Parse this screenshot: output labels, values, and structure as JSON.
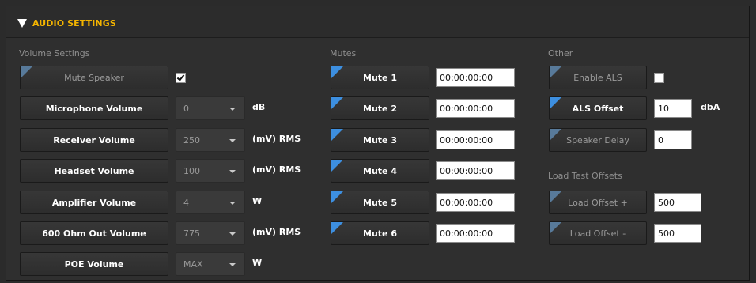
{
  "header": {
    "title": "AUDIO SETTINGS"
  },
  "volume": {
    "section_label": "Volume Settings",
    "mute_speaker": {
      "label": "Mute Speaker",
      "checked": true
    },
    "rows": [
      {
        "label": "Microphone Volume",
        "value": "0",
        "unit": "dB"
      },
      {
        "label": "Receiver Volume",
        "value": "250",
        "unit": "(mV) RMS"
      },
      {
        "label": "Headset Volume",
        "value": "100",
        "unit": "(mV) RMS"
      },
      {
        "label": "Amplifier Volume",
        "value": "4",
        "unit": "W"
      },
      {
        "label": "600 Ohm Out Volume",
        "value": "775",
        "unit": "(mV) RMS"
      },
      {
        "label": "POE Volume",
        "value": "MAX",
        "unit": "W"
      }
    ]
  },
  "mutes": {
    "section_label": "Mutes",
    "items": [
      {
        "label": "Mute 1",
        "time": "00:00:00:00"
      },
      {
        "label": "Mute 2",
        "time": "00:00:00:00"
      },
      {
        "label": "Mute 3",
        "time": "00:00:00:00"
      },
      {
        "label": "Mute 4",
        "time": "00:00:00:00"
      },
      {
        "label": "Mute 5",
        "time": "00:00:00:00"
      },
      {
        "label": "Mute 6",
        "time": "00:00:00:00"
      }
    ]
  },
  "other": {
    "section_label": "Other",
    "enable_als": {
      "label": "Enable ALS",
      "checked": false
    },
    "als_offset": {
      "label": "ALS Offset",
      "value": "10",
      "unit": "dbA"
    },
    "speaker_delay": {
      "label": "Speaker Delay",
      "value": "0"
    }
  },
  "load_test": {
    "section_label": "Load Test Offsets",
    "plus": {
      "label": "Load Offset +",
      "value": "500"
    },
    "minus": {
      "label": "Load Offset -",
      "value": "500"
    }
  },
  "colors": {
    "accent": "#f3b400",
    "corner_blue": "#3d8fe0",
    "panel": "#2f2f2f"
  },
  "icons": {
    "expand": "triangle-down-icon"
  }
}
